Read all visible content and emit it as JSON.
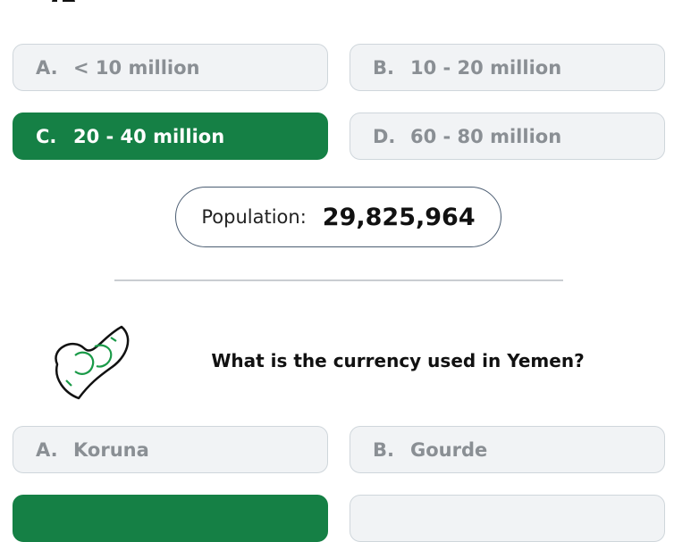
{
  "population_question": {
    "options": [
      {
        "letter": "A.",
        "text": "< 10 million"
      },
      {
        "letter": "B.",
        "text": "10 - 20 million"
      },
      {
        "letter": "C.",
        "text": "20 - 40 million"
      },
      {
        "letter": "D.",
        "text": "60 - 80 million"
      }
    ],
    "correct_option": "C",
    "population_label": "Population:",
    "population_value": "29,825,964"
  },
  "currency_question": {
    "icon": "money-icon",
    "question": "What is the currency used in Yemen?",
    "options": [
      {
        "letter": "A.",
        "text": "Koruna"
      },
      {
        "letter": "B.",
        "text": "Gourde"
      }
    ]
  },
  "colors": {
    "correct_green": "#158045",
    "option_bg": "#f1f3f5",
    "option_text": "#8a8f94",
    "icon_green": "#1a9a48"
  }
}
